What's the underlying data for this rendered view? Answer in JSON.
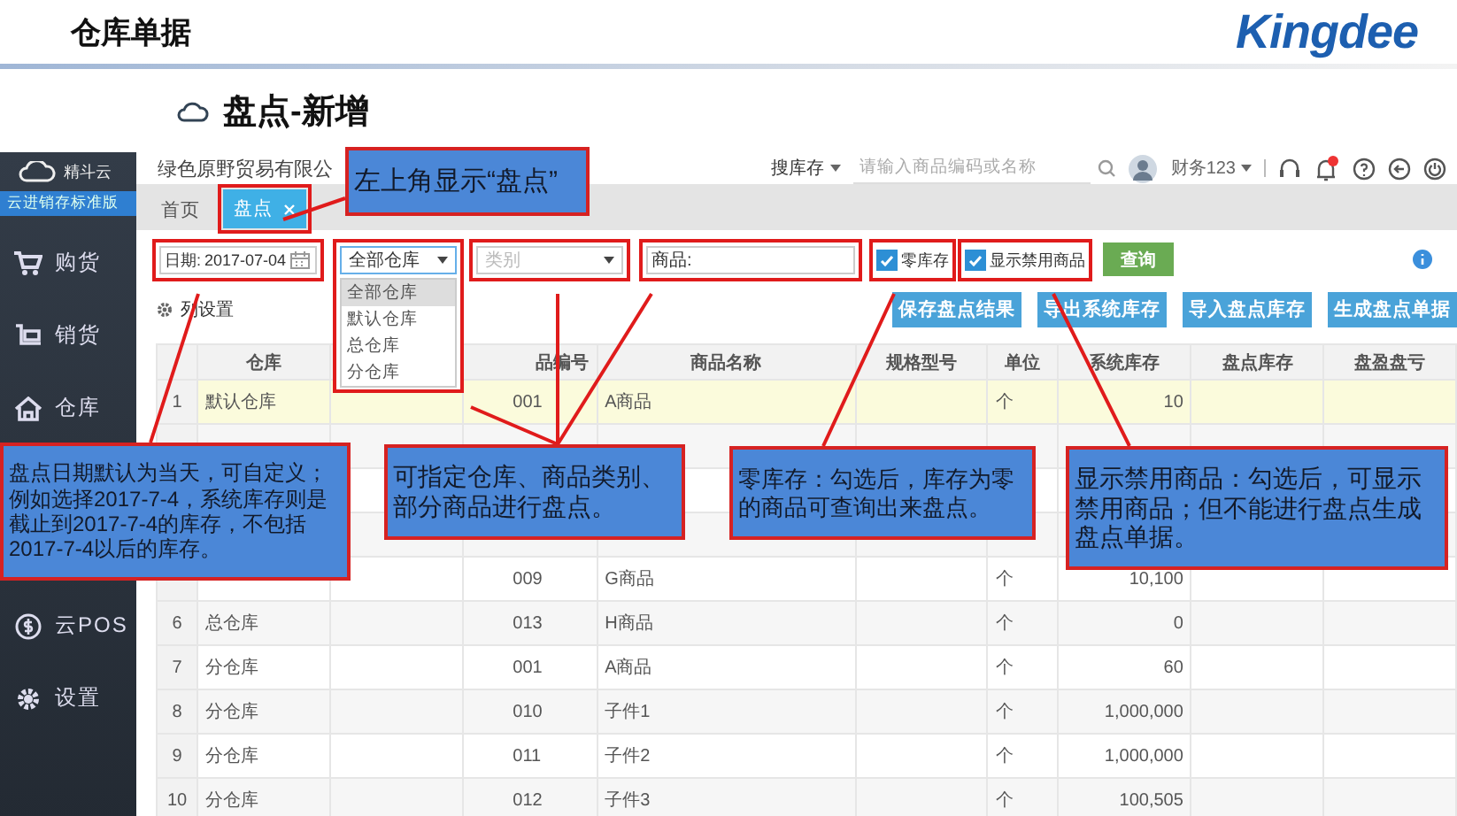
{
  "slide": {
    "title": "仓库单据",
    "logo": "Kingdee"
  },
  "page_title": "盘点-新增",
  "sidebar": {
    "brand": "精斗云",
    "edition": "云进销存标准版",
    "items": [
      {
        "label": "购货"
      },
      {
        "label": "销货"
      },
      {
        "label": "仓库"
      },
      {
        "label": "云POS"
      },
      {
        "label": "设置"
      }
    ]
  },
  "top_bar": {
    "company": "绿色原野贸易有限公",
    "search_scope": "搜库存",
    "search": {
      "placeholder": "请输入商品编码或名称"
    },
    "user": "财务123"
  },
  "tabs": [
    {
      "label": "首页",
      "selected": false,
      "closable": false
    },
    {
      "label": "盘点",
      "selected": true,
      "closable": true
    }
  ],
  "filters": {
    "date_label": "日期:",
    "date": "2017-07-04",
    "warehouse": {
      "value": "全部仓库",
      "expanded": true,
      "options": [
        {
          "label": "全部仓库",
          "selected": true
        },
        {
          "label": "默认仓库",
          "selected": false
        },
        {
          "label": "总仓库",
          "selected": false
        },
        {
          "label": "分仓库",
          "selected": false
        }
      ]
    },
    "category": {
      "placeholder": "类别"
    },
    "product_label": "商品:",
    "checkboxes": [
      {
        "label": "零库存",
        "checked": true
      },
      {
        "label": "显示禁用商品",
        "checked": true
      }
    ],
    "query_button": "查询"
  },
  "column_settings": "列设置",
  "actions": [
    "保存盘点结果",
    "导出系统库存",
    "导入盘点库存",
    "生成盘点单据"
  ],
  "table": {
    "columns": {
      "warehouse": "仓库",
      "code": "品编号",
      "name": "商品名称",
      "spec": "规格型号",
      "unit": "单位",
      "system_stock": "系统库存",
      "counted_stock": "盘点库存",
      "difference": "盘盈盘亏"
    },
    "rows": [
      {
        "num": "1",
        "warehouse": "默认仓库",
        "code": "001",
        "name": "A商品",
        "unit": "个",
        "system_stock": "10",
        "selected": true
      },
      {
        "selected": false
      },
      {
        "selected": false
      },
      {
        "selected": false
      },
      {
        "code": "009",
        "name": "G商品",
        "unit": "个",
        "system_stock": "10,100",
        "selected": false
      },
      {
        "num": "6",
        "warehouse": "总仓库",
        "code": "013",
        "name": "H商品",
        "unit": "个",
        "system_stock": "0",
        "selected": false
      },
      {
        "num": "7",
        "warehouse": "分仓库",
        "code": "001",
        "name": "A商品",
        "unit": "个",
        "system_stock": "60",
        "selected": false
      },
      {
        "num": "8",
        "warehouse": "分仓库",
        "code": "010",
        "name": "子件1",
        "unit": "个",
        "system_stock": "1,000,000",
        "selected": false
      },
      {
        "num": "9",
        "warehouse": "分仓库",
        "code": "011",
        "name": "子件2",
        "unit": "个",
        "system_stock": "1,000,000",
        "selected": false
      },
      {
        "num": "10",
        "warehouse": "分仓库",
        "code": "012",
        "name": "子件3",
        "unit": "个",
        "system_stock": "100,505",
        "selected": false
      }
    ]
  },
  "callouts": [
    {
      "text": "左上角显示“盘点”"
    },
    {
      "text": "盘点日期默认为当天，可自定义；例如选择2017-7-4，系统库存则是截止到2017-7-4的库存，不包括2017-7-4以后的库存。"
    },
    {
      "text": "可指定仓库、商品类别、部分商品进行盘点。"
    },
    {
      "text": "零库存：勾选后，库存为零的商品可查询出来盘点。"
    },
    {
      "text": "显示禁用商品：勾选后，可显示禁用商品；但不能进行盘点生成盘点单据。"
    }
  ]
}
